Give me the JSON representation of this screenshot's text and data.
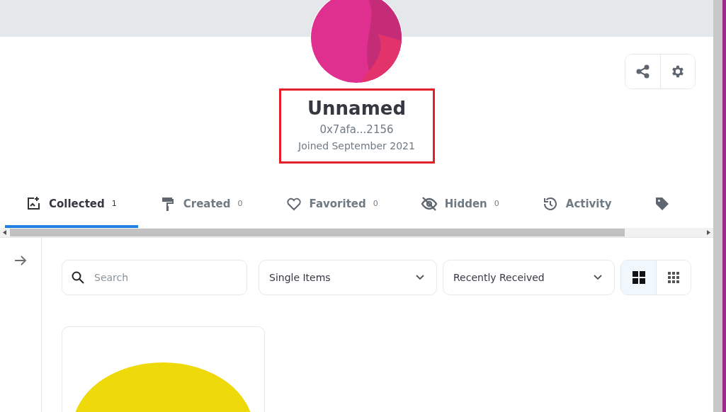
{
  "profile": {
    "name": "Unnamed",
    "address": "0x7afa...2156",
    "joined": "Joined September 2021",
    "highlighted": true
  },
  "tabs": [
    {
      "label": "Collected",
      "count": "1",
      "selected": true
    },
    {
      "label": "Created",
      "count": "0",
      "selected": false
    },
    {
      "label": "Favorited",
      "count": "0",
      "selected": false
    },
    {
      "label": "Hidden",
      "count": "0",
      "selected": false
    },
    {
      "label": "Activity",
      "selected": false
    },
    {
      "selected": false
    }
  ],
  "search": {
    "placeholder": "Search"
  },
  "filters": [
    {
      "value": "Single Items"
    },
    {
      "value": "Recently Received"
    }
  ],
  "view_toggle": [
    {
      "selected": true
    },
    {
      "selected": false
    }
  ]
}
